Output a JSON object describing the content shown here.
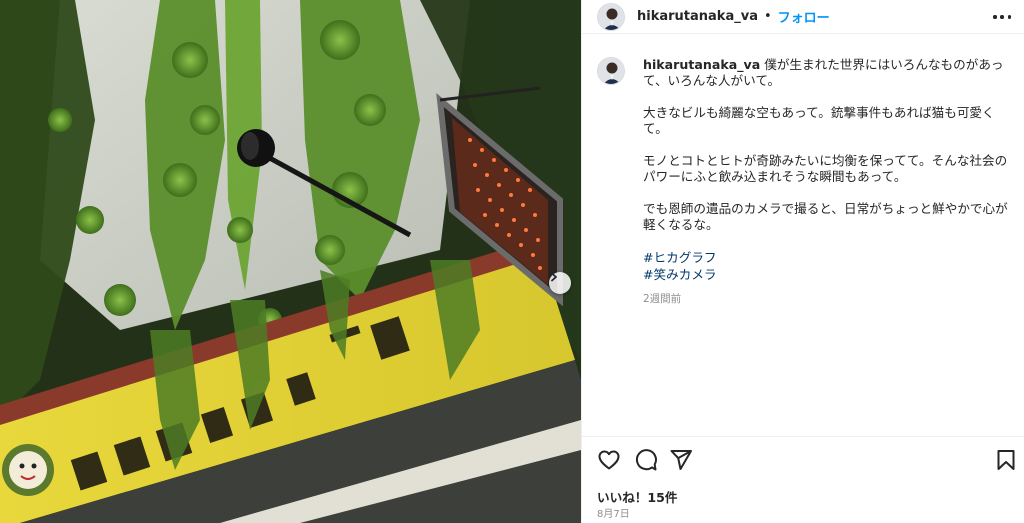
{
  "post": {
    "username": "hikarutanaka_va",
    "separator": "•",
    "follow_label": "フォロー",
    "more_icon": "more-options-icon"
  },
  "caption": {
    "username": "hikarutanaka_va",
    "paragraphs": [
      "僕が生まれた世界にはいろんなものがあって、いろんな人がいて。",
      "大きなビルも綺麗な空もあって。銃撃事件もあれば猫も可愛くて。",
      "モノとコトとヒトが奇跡みたいに均衡を保ってて。そんな社会のパワーにふと飲み込まれそうな瞬間もあって。",
      "でも恩師の遺品のカメラで撮ると、日常がちょっと鮮やかで心が軽くなるな。"
    ],
    "hashtags": [
      "#ヒカグラフ",
      "#笑みカメラ"
    ],
    "time_ago": "2週間前"
  },
  "photo": {
    "sign_text": "飲食笑動 居酒屋 ね一膳",
    "next_icon": "chevron-right-icon"
  },
  "actions": {
    "like_icon": "heart-icon",
    "comment_icon": "comment-icon",
    "share_icon": "paper-plane-icon",
    "save_icon": "bookmark-icon",
    "likes_text": "いいね！15件",
    "date": "8月7日"
  },
  "colors": {
    "link": "#0095f6",
    "hashtag": "#00376b",
    "muted": "#8e8e8e",
    "sign_yellow": "#e6d43a",
    "ivy_green": "#5f9a2e"
  }
}
